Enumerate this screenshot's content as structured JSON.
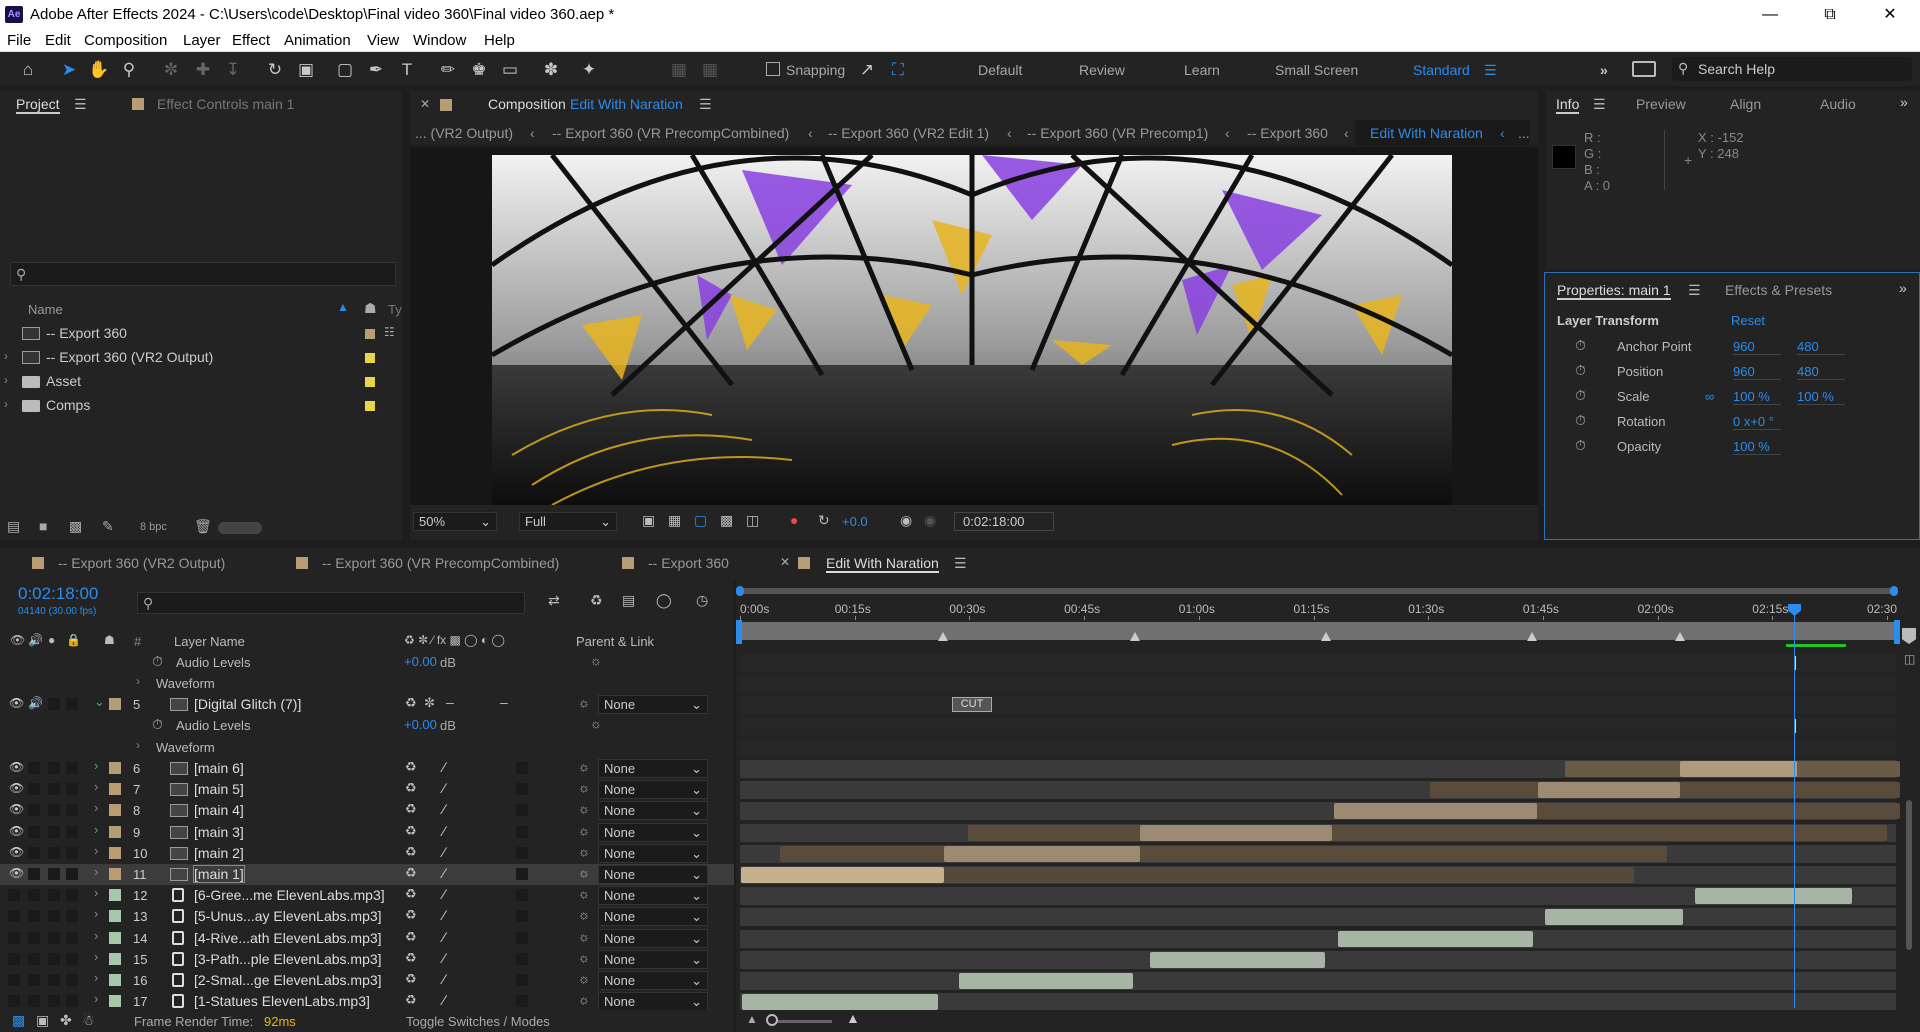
{
  "window": {
    "title": "Adobe After Effects 2024 - C:\\Users\\code\\Desktop\\Final video 360\\Final video 360.aep *",
    "app_icon": "Ae"
  },
  "menu": [
    "File",
    "Edit",
    "Composition",
    "Layer",
    "Effect",
    "Animation",
    "View",
    "Window",
    "Help"
  ],
  "toolbar": {
    "snapping": "Snapping",
    "workspaces": [
      "Default",
      "Review",
      "Learn",
      "Small Screen",
      "Standard"
    ],
    "active_workspace": "Standard",
    "search_placeholder": "Search Help"
  },
  "project_panel": {
    "tab": "Project",
    "effect_controls_tab": "Effect Controls main 1",
    "column_name": "Name",
    "items": [
      {
        "name": "-- Export 360",
        "color": "#b89c74",
        "type": "composition"
      },
      {
        "name": "-- Export 360 (VR2 Output)",
        "color": "#e8d44d",
        "type": "composition"
      },
      {
        "name": "Asset",
        "color": "#e8d44d",
        "type": "folder"
      },
      {
        "name": "Comps",
        "color": "#e8d44d",
        "type": "folder"
      }
    ],
    "bpc": "8 bpc"
  },
  "composition_panel": {
    "label": "Composition",
    "name": "Edit With Naration",
    "breadcrumbs": [
      "... (VR2 Output)",
      "-- Export 360 (VR PrecompCombined)",
      "-- Export 360 (VR2 Edit 1)",
      "-- Export 360 (VR Precomp1)",
      "-- Export 360",
      "Edit With Naration"
    ],
    "zoom": "50%",
    "resolution": "Full",
    "exposure": "+0.0",
    "timecode": "0:02:18:00"
  },
  "info_panel": {
    "tabs": [
      "Info",
      "Preview",
      "Align",
      "Audio"
    ],
    "r": "R :",
    "g": "G :",
    "b": "B :",
    "a": "A : 0",
    "x": "X : -152",
    "y": "Y : 248"
  },
  "properties_panel": {
    "tab": "Properties: main 1",
    "other_tab": "Effects & Presets",
    "section": "Layer Transform",
    "reset": "Reset",
    "props": [
      {
        "name": "Anchor Point",
        "v1": "960",
        "v2": "480"
      },
      {
        "name": "Position",
        "v1": "960",
        "v2": "480"
      },
      {
        "name": "Scale",
        "v1": "100 %",
        "v2": "100 %"
      },
      {
        "name": "Rotation",
        "v1": "0 x+0 °",
        "v2": ""
      },
      {
        "name": "Opacity",
        "v1": "100 %",
        "v2": ""
      }
    ]
  },
  "timeline": {
    "tabs": [
      "-- Export 360 (VR2 Output)",
      "-- Export 360 (VR PrecompCombined)",
      "-- Export 360",
      "Edit With Naration"
    ],
    "timecode": "0:02:18:00",
    "frame_info": "04140 (30.00 fps)",
    "col_headers": {
      "num": "#",
      "layer_name": "Layer Name",
      "parent": "Parent & Link"
    },
    "ruler": [
      "0:00s",
      "00:15s",
      "00:30s",
      "00:45s",
      "01:00s",
      "01:15s",
      "01:30s",
      "01:45s",
      "02:00s",
      "02:15s",
      "02:30"
    ],
    "cut_label": "CUT",
    "audio_levels": "Audio Levels",
    "audio_value": "+0.00",
    "audio_unit": "dB",
    "waveform": "Waveform",
    "layers": [
      {
        "num": "5",
        "name": "[Digital Glitch (7)]",
        "color": "#b89c74",
        "parent": "None"
      },
      {
        "num": "6",
        "name": "[main 6]",
        "color": "#b89c74",
        "parent": "None"
      },
      {
        "num": "7",
        "name": "[main 5]",
        "color": "#b89c74",
        "parent": "None"
      },
      {
        "num": "8",
        "name": "[main 4]",
        "color": "#b89c74",
        "parent": "None"
      },
      {
        "num": "9",
        "name": "[main 3]",
        "color": "#b89c74",
        "parent": "None"
      },
      {
        "num": "10",
        "name": "[main 2]",
        "color": "#b89c74",
        "parent": "None"
      },
      {
        "num": "11",
        "name": "[main 1]",
        "color": "#b89c74",
        "parent": "None"
      },
      {
        "num": "12",
        "name": "[6-Gree...me ElevenLabs.mp3]",
        "color": "#a6c8a8",
        "parent": "None"
      },
      {
        "num": "13",
        "name": "[5-Unus...ay ElevenLabs.mp3]",
        "color": "#a6c8a8",
        "parent": "None"
      },
      {
        "num": "14",
        "name": "[4-Rive...ath ElevenLabs.mp3]",
        "color": "#a6c8a8",
        "parent": "None"
      },
      {
        "num": "15",
        "name": "[3-Path...ple ElevenLabs.mp3]",
        "color": "#a6c8a8",
        "parent": "None"
      },
      {
        "num": "16",
        "name": "[2-Smal...ge ElevenLabs.mp3]",
        "color": "#a6c8a8",
        "parent": "None"
      },
      {
        "num": "17",
        "name": "[1-Statues ElevenLabs.mp3]",
        "color": "#a6c8a8",
        "parent": "None"
      }
    ],
    "frame_render_label": "Frame Render Time:",
    "frame_render_value": "92ms",
    "toggle": "Toggle Switches / Modes"
  }
}
